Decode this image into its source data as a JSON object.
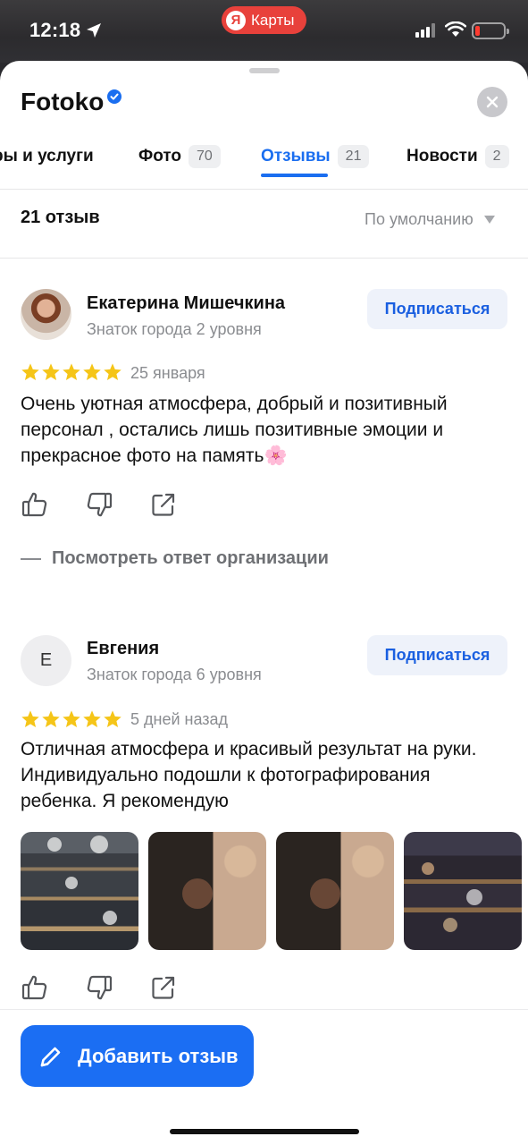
{
  "status_bar": {
    "time": "12:18",
    "app_pill_logo": "Я",
    "app_pill_label": "Карты"
  },
  "header": {
    "title": "Fotoko",
    "verified_icon": "verified-badge-icon",
    "close_icon": "close-icon"
  },
  "tabs": [
    {
      "label": "ры и услуги",
      "count": ""
    },
    {
      "label": "Фото",
      "count": "70"
    },
    {
      "label": "Отзывы",
      "count": "21",
      "active": true
    },
    {
      "label": "Новости",
      "count": "2"
    }
  ],
  "reviews_header": {
    "count_label": "21 отзыв",
    "sort_label": "По умолчанию"
  },
  "reviews": [
    {
      "author": "Екатерина Мишечкина",
      "level": "Знаток города 2 уровня",
      "subscribe_label": "Подписаться",
      "rating": 5,
      "date": "25 января",
      "text": "Очень уютная атмосфера, добрый и позитивный персонал , остались лишь позитивные эмоции и прекрасное фото на память🌸",
      "org_reply_label": "Посмотреть ответ организации"
    },
    {
      "author": "Евгения",
      "avatar_letter": "Е",
      "level": "Знаток города 6 уровня",
      "subscribe_label": "Подписаться",
      "rating": 5,
      "date": "5 дней назад",
      "text": "Отличная атмосфера и красивый результат на руки. Индивидуально подошли к фотографирования ребенка. Я рекомендую",
      "photo_count": 4
    }
  ],
  "footer": {
    "add_review_label": "Добавить отзыв"
  },
  "colors": {
    "accent": "#1b6ef3",
    "star": "#f5c518",
    "maps_red": "#e8413b"
  }
}
